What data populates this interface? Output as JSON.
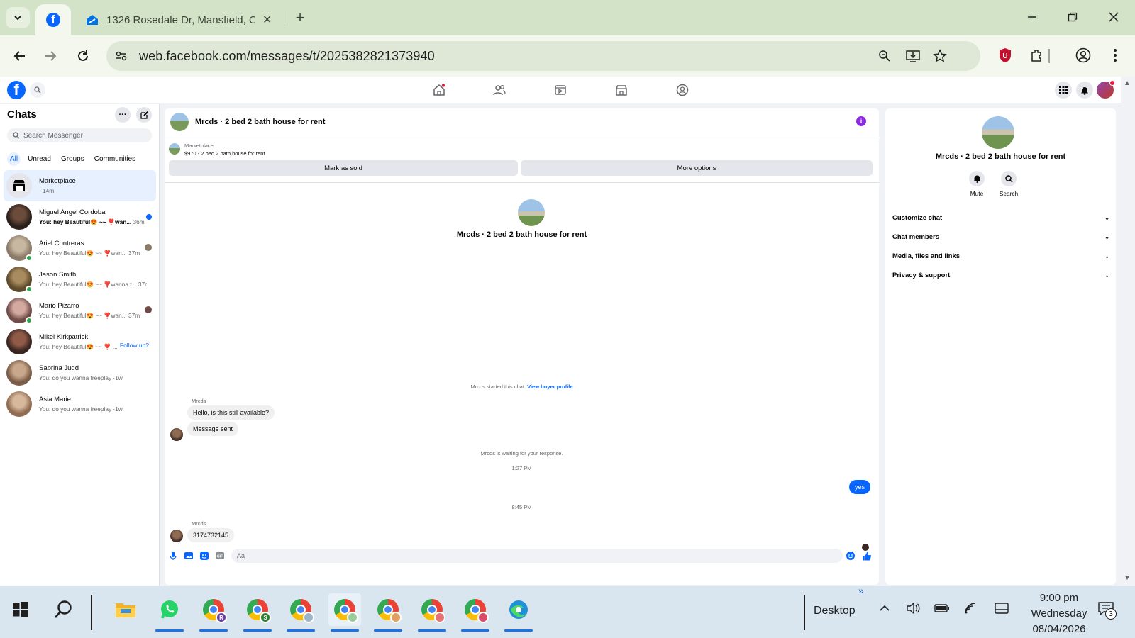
{
  "browser": {
    "active_tab_icon": "facebook-icon",
    "second_tab_title": "1326 Rosedale Dr, Mansfield, O",
    "url": "web.facebook.com/messages/t/2025382821373940"
  },
  "colors": {
    "facebook_blue": "#0866ff",
    "online_green": "#31a24c",
    "info_purple": "#8a2be2",
    "tabstrip": "#d3e3c7"
  },
  "chats": {
    "title": "Chats",
    "search_placeholder": "Search Messenger",
    "filters": [
      "All",
      "Unread",
      "Groups",
      "Communities"
    ],
    "items": [
      {
        "name": "Marketplace",
        "preview": "· 14m",
        "online": false
      },
      {
        "name": "Miguel Angel Cordoba",
        "preview": "You: hey Beautiful😍 ~~ ❣️wan...",
        "time": "36m",
        "unread": true
      },
      {
        "name": "Ariel Contreras",
        "preview": "You: hey Beautiful😍 ~~ ❣️wan...",
        "time": "37m",
        "online": true
      },
      {
        "name": "Jason Smith",
        "preview": "You: hey Beautiful😍 ~~ ❣️wanna t...",
        "time": "37m",
        "online": true
      },
      {
        "name": "Mario Pizarro",
        "preview": "You: hey Beautiful😍 ~~ ❣️wan...",
        "time": "37m",
        "online": true
      },
      {
        "name": "Mikel Kirkpatrick",
        "preview": "You: hey Beautiful😍 ~~ ❣️ ...",
        "follow_up": "Follow up?"
      },
      {
        "name": "Sabrina Judd",
        "preview": "You: do you wanna freeplay",
        "time": "1w"
      },
      {
        "name": "Asia Marie",
        "preview": "You: do you wanna freeplay",
        "time": "1w"
      }
    ]
  },
  "conversation": {
    "title": "Mrcds · 2 bed 2 bath house for rent",
    "marketplace_label": "Marketplace",
    "listing": "$970 - 2 bed 2 bath house for rent",
    "mark_sold": "Mark as sold",
    "more_options": "More options",
    "started_text": "Mrcds started this chat.",
    "view_buyer": "View buyer profile",
    "sender": "Mrcds",
    "msg1": "Hello, is this still available?",
    "msg2": "Message sent",
    "waiting": "Mrcds is waiting for your response.",
    "time1": "1:27 PM",
    "out_msg": "yes",
    "time2": "8:45 PM",
    "msg3": "3174732145",
    "composer_placeholder": "Aa"
  },
  "info_panel": {
    "title": "Mrcds · 2 bed 2 bath house for rent",
    "mute": "Mute",
    "search": "Search",
    "sections": [
      "Customize chat",
      "Chat members",
      "Media, files and links",
      "Privacy & support"
    ]
  },
  "taskbar": {
    "desktop_label": "Desktop",
    "time": "9:00 pm",
    "day": "Wednesday",
    "date": "08/04/2026",
    "notification_count": "3",
    "chrome_badges": [
      "R",
      "S"
    ]
  }
}
